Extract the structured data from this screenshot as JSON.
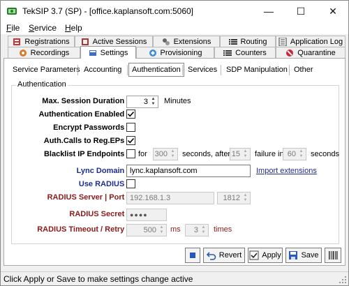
{
  "window": {
    "title": "TekSIP 3.7 (SP) - [office.kaplansoft.com:5060]",
    "minimize_glyph": "—",
    "maximize_glyph": "☐",
    "close_glyph": "✕"
  },
  "menu": {
    "items": [
      {
        "label": "File",
        "mnemonic": "F",
        "rest": "ile"
      },
      {
        "label": "Service",
        "mnemonic": "S",
        "rest": "ervice"
      },
      {
        "label": "Help",
        "mnemonic": "H",
        "rest": "elp"
      }
    ]
  },
  "tabs": {
    "row1": [
      "Registrations",
      "Active Sessions",
      "Extensions",
      "Routing",
      "Application Log"
    ],
    "row2": [
      "Recordings",
      "Settings",
      "Provisioning",
      "Counters",
      "Quarantine"
    ],
    "active": "Settings"
  },
  "subtabs": {
    "items": [
      "Service Parameters",
      "Accounting",
      "Authentication",
      "Services",
      "SDP Manipulation",
      "Other"
    ],
    "active": "Authentication"
  },
  "auth": {
    "group_title": "Authentication",
    "max_session_label": "Max. Session Duration :",
    "max_session_value": "3",
    "max_session_unit": "Minutes",
    "auth_enabled_label": "Authentication Enabled :",
    "auth_enabled": true,
    "encrypt_label": "Encrypt Passwords :",
    "encrypt": false,
    "auth_calls_label": "Auth.Calls to Reg.EPs :",
    "auth_calls": true,
    "blacklist_label": "Blacklist IP Endpoints :",
    "blacklist": false,
    "blacklist_for": "for",
    "blacklist_seconds_value": "300",
    "blacklist_seconds_after": "seconds, after",
    "blacklist_failure_value": "15",
    "blacklist_failure_in": "failure in",
    "blacklist_window_value": "60",
    "blacklist_seconds": "seconds",
    "lync_label": "Lync Domain :",
    "lync_value": "lync.kaplansoft.com",
    "import_link": "Import extensions",
    "use_radius_label": "Use RADIUS :",
    "use_radius": false,
    "radius_server_label": "RADIUS Server | Port :",
    "radius_server_value": "192.168.1.3",
    "radius_port_value": "1812",
    "radius_secret_label": "RADIUS Secret :",
    "radius_secret_value": "●●●●",
    "radius_timeout_label": "RADIUS Timeout / Retry :",
    "radius_timeout_value": "500",
    "radius_timeout_unit": "ms",
    "radius_retry_value": "3",
    "radius_retry_unit": "times"
  },
  "buttons": {
    "revert": "Revert",
    "apply": "Apply",
    "save": "Save"
  },
  "status": {
    "text": "Click Apply or Save to make settings change active"
  },
  "colors": {
    "label_blue": "#1f2d8a",
    "label_red": "#8b1a1a"
  }
}
